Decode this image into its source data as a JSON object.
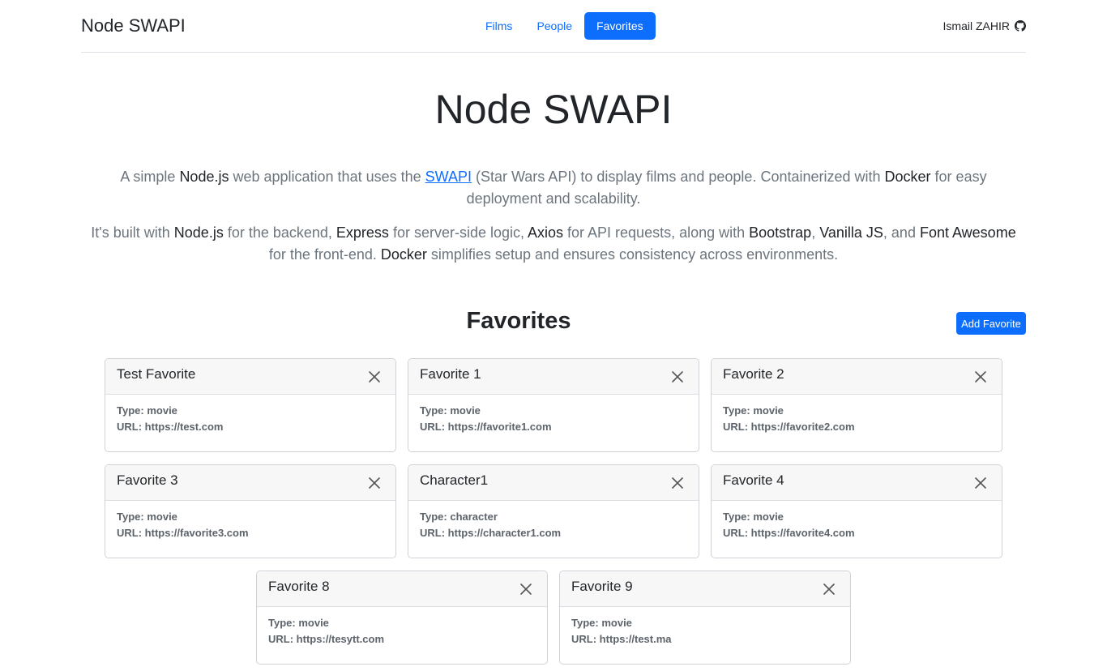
{
  "navbar": {
    "brand": "Node SWAPI",
    "links": [
      {
        "label": "Films",
        "active": false
      },
      {
        "label": "People",
        "active": false
      },
      {
        "label": "Favorites",
        "active": true
      }
    ],
    "author": "Ismail ZAHIR",
    "author_icon": "github-icon"
  },
  "hero": {
    "title": "Node SWAPI",
    "lead1": {
      "t1": "A simple ",
      "h1": "Node.js",
      "t2": " web application that uses the ",
      "link": "SWAPI",
      "t3": " (Star Wars API) to display films and people. Containerized with ",
      "h2": "Docker",
      "t4": " for easy deployment and scalability."
    },
    "lead2": {
      "t1": "It's built with ",
      "h1": "Node.js",
      "t2": " for the backend, ",
      "h2": "Express",
      "t3": " for server-side logic, ",
      "h3": "Axios",
      "t4": " for API requests, along with ",
      "h4": "Bootstrap",
      "t5": ", ",
      "h5": "Vanilla JS",
      "t6": ", and ",
      "h6": "Font Awesome",
      "t7": " for the front-end. ",
      "h7": "Docker",
      "t8": " simplifies setup and ensures consistency across environments."
    }
  },
  "favorites": {
    "title": "Favorites",
    "add_label": "Add Favorite",
    "type_label": "Type:",
    "url_label": "URL:",
    "items": [
      {
        "name": "Test Favorite",
        "type": "movie",
        "url": "https://test.com"
      },
      {
        "name": "Favorite 1",
        "type": "movie",
        "url": "https://favorite1.com"
      },
      {
        "name": "Favorite 2",
        "type": "movie",
        "url": "https://favorite2.com"
      },
      {
        "name": "Favorite 3",
        "type": "movie",
        "url": "https://favorite3.com"
      },
      {
        "name": "Character1",
        "type": "character",
        "url": "https://character1.com"
      },
      {
        "name": "Favorite 4",
        "type": "movie",
        "url": "https://favorite4.com"
      },
      {
        "name": "Favorite 8",
        "type": "movie",
        "url": "https://tesytt.com"
      },
      {
        "name": "Favorite 9",
        "type": "movie",
        "url": "https://test.ma"
      }
    ]
  },
  "colors": {
    "primary": "#0d6efd",
    "muted": "#6c757d"
  }
}
